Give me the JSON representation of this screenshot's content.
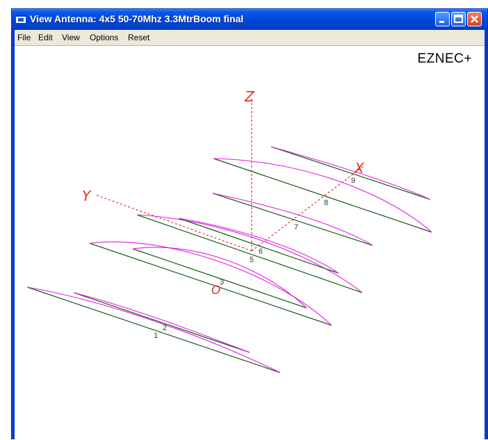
{
  "window": {
    "title": "View Antenna: 4x5 50-70Mhz 3.3MtrBoom final",
    "icon": "app-icon"
  },
  "titlebar_buttons": {
    "minimize_icon": "minimize-icon",
    "maximize_icon": "maximize-icon",
    "close_icon": "close-icon"
  },
  "menu": {
    "items": [
      {
        "label": "File"
      },
      {
        "label": "Edit"
      },
      {
        "label": "View"
      },
      {
        "label": "Options"
      },
      {
        "label": "Reset"
      }
    ]
  },
  "brand": "EZNEC+",
  "axes": {
    "z_label": "Z",
    "y_label": "Y",
    "x_label": "X",
    "color": "#e03030"
  },
  "wire_labels": {
    "w1": "1",
    "w2": "2",
    "w3": "3",
    "w5": "5",
    "w6": "6",
    "w7": "7",
    "w8": "8",
    "w9": "9"
  },
  "source_marker": "O",
  "colors": {
    "wire": "#1a5a1a",
    "current": "#e020e0",
    "axis": "#e03030"
  }
}
